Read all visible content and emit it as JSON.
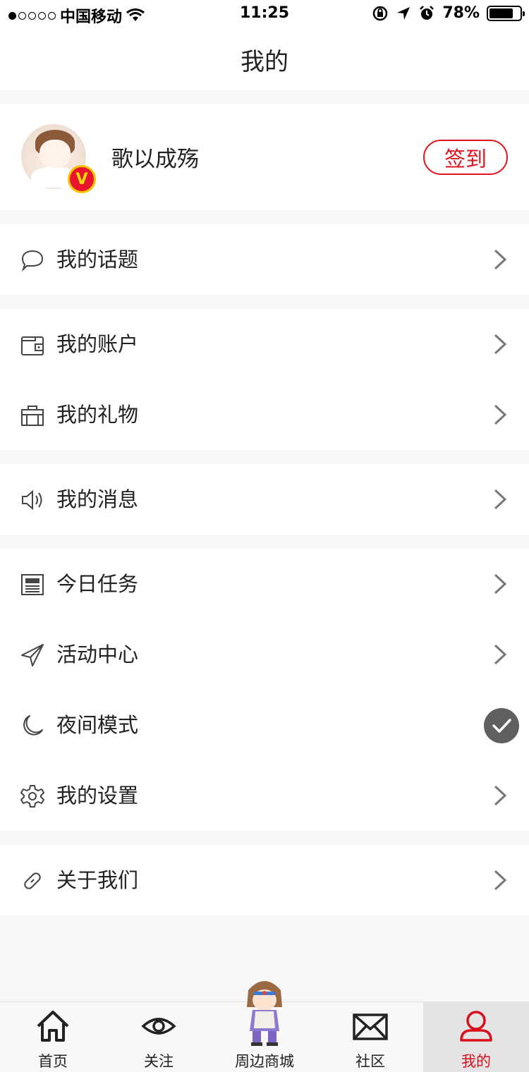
{
  "status_bar": {
    "carrier": "中国移动",
    "time": "11:25",
    "battery": "78%"
  },
  "nav": {
    "title": "我的"
  },
  "profile": {
    "username": "歌以成殇",
    "vip_badge": "V",
    "checkin_label": "签到"
  },
  "menu": {
    "topics": "我的话题",
    "account": "我的账户",
    "gifts": "我的礼物",
    "messages": "我的消息",
    "daily_tasks": "今日任务",
    "activity_center": "活动中心",
    "night_mode": "夜间模式",
    "settings": "我的设置",
    "about_us": "关于我们"
  },
  "tabs": [
    {
      "label": "首页",
      "icon": "home-icon"
    },
    {
      "label": "关注",
      "icon": "eye-icon"
    },
    {
      "label": "周边商城",
      "icon": "mascot-icon"
    },
    {
      "label": "社区",
      "icon": "envelope-icon"
    },
    {
      "label": "我的",
      "icon": "user-icon",
      "active": true
    }
  ],
  "colors": {
    "accent": "#e0141e",
    "text": "#222222",
    "icon": "#555555"
  },
  "night_mode_enabled": true
}
